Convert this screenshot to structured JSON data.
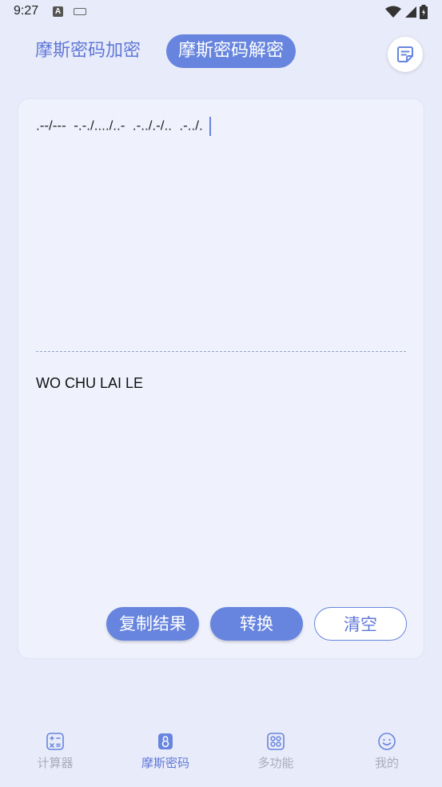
{
  "status": {
    "time": "9:27",
    "a_badge": "A"
  },
  "tabs": [
    {
      "label": "摩斯密码加密",
      "active": false
    },
    {
      "label": "摩斯密码解密",
      "active": true
    }
  ],
  "notes_icon": "notes-icon",
  "input": {
    "morse": ".--/---  -.-./..../..-  .-../.-/..  .-../."
  },
  "output": {
    "text": "WO CHU LAI LE"
  },
  "buttons": {
    "copy": "复制结果",
    "convert": "转换",
    "clear": "清空"
  },
  "nav": [
    {
      "label": "计算器",
      "icon": "calculator-icon",
      "active": false
    },
    {
      "label": "摩斯密码",
      "icon": "lock-icon",
      "active": true
    },
    {
      "label": "多功能",
      "icon": "grid-icon",
      "active": false
    },
    {
      "label": "我的",
      "icon": "smiley-icon",
      "active": false
    }
  ],
  "colors": {
    "accent": "#6785de",
    "background": "#e8ebf9",
    "card": "#eff2fd"
  }
}
